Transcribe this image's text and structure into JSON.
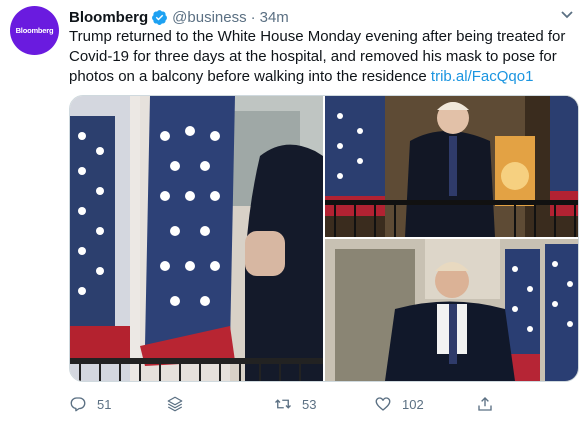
{
  "account": {
    "name": "Bloomberg",
    "handle": "@business",
    "separator": "·",
    "time": "34m",
    "avatar_text": "Bloomberg",
    "verified_icon": "verified-badge-icon",
    "brand_color": "#6a1bdf"
  },
  "tweet": {
    "text": "Trump returned to the White House Monday evening after being treated for Covid-19 for three days at the hospital, and removed his mask to pose for photos on a balcony before walking into the residence ",
    "link": "trib.al/FacQqo1"
  },
  "actions": {
    "reply_count": "51",
    "retweet_count": "53",
    "like_count": "102"
  },
  "colors": {
    "text": "#0f1419",
    "secondary": "#5b7083",
    "link": "#1b95e0",
    "verified": "#1da1f2"
  }
}
